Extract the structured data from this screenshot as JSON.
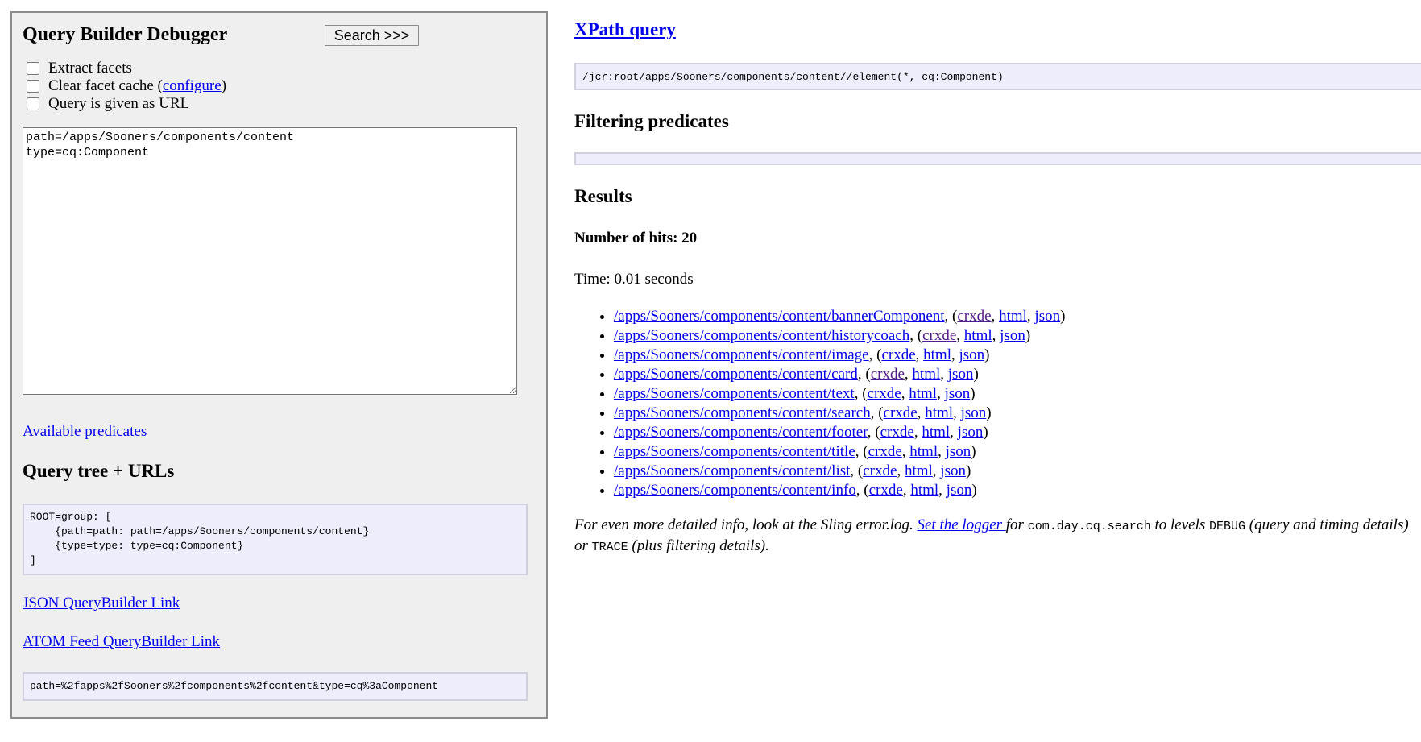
{
  "left_panel": {
    "title": "Query Builder Debugger",
    "search_button": "Search >>>",
    "options": {
      "extract_facets": "Extract facets",
      "clear_cache_prefix": "Clear facet cache (",
      "configure_link": "configure",
      "clear_cache_suffix": ")",
      "query_as_url": "Query is given as URL"
    },
    "query_text": "path=/apps/Sooners/components/content\ntype=cq:Component",
    "available_predicates": "Available predicates",
    "query_tree_title": "Query tree + URLs",
    "query_tree": "ROOT=group: [\n    {path=path: path=/apps/Sooners/components/content}\n    {type=type: type=cq:Component}\n]",
    "json_link": "JSON QueryBuilder Link",
    "atom_link": "ATOM Feed QueryBuilder Link",
    "url_params": "path=%2fapps%2fSooners%2fcomponents%2fcontent&type=cq%3aComponent"
  },
  "right_panel": {
    "xpath_heading": "XPath query",
    "xpath": "/jcr:root/apps/Sooners/components/content//element(*, cq:Component)",
    "filtering_title": "Filtering predicates",
    "results_title": "Results",
    "hits": "Number of hits: 20",
    "time": "Time: 0.01 seconds",
    "results": [
      {
        "path": "/apps/Sooners/components/content/bannerComponent",
        "crxde_visited": true
      },
      {
        "path": "/apps/Sooners/components/content/historycoach",
        "crxde_visited": true
      },
      {
        "path": "/apps/Sooners/components/content/image",
        "crxde_visited": false
      },
      {
        "path": "/apps/Sooners/components/content/card",
        "crxde_visited": true
      },
      {
        "path": "/apps/Sooners/components/content/text",
        "crxde_visited": false
      },
      {
        "path": "/apps/Sooners/components/content/search",
        "crxde_visited": false
      },
      {
        "path": "/apps/Sooners/components/content/footer",
        "crxde_visited": false
      },
      {
        "path": "/apps/Sooners/components/content/title",
        "crxde_visited": false
      },
      {
        "path": "/apps/Sooners/components/content/list",
        "crxde_visited": false
      },
      {
        "path": "/apps/Sooners/components/content/info",
        "crxde_visited": false
      }
    ],
    "link_labels": {
      "crxde": "crxde",
      "html": "html",
      "json": "json"
    },
    "punctuation": {
      "after_path": ", (",
      "sep": ", ",
      "close": ")"
    },
    "debug_note": {
      "part1": "For even more detailed info, look at the Sling error.log. ",
      "logger_link": "Set the logger ",
      "part2": "for ",
      "code1": "com.day.cq.search",
      "part3": " to levels ",
      "code2": "DEBUG",
      "part4": " (query and timing details) or ",
      "code3": "TRACE",
      "part5": " (plus filtering details)."
    }
  },
  "colors": {
    "panel_bg": "#efefef",
    "code_bg": "#ededfb",
    "link": "#0000ee",
    "visited": "#551a8b"
  }
}
